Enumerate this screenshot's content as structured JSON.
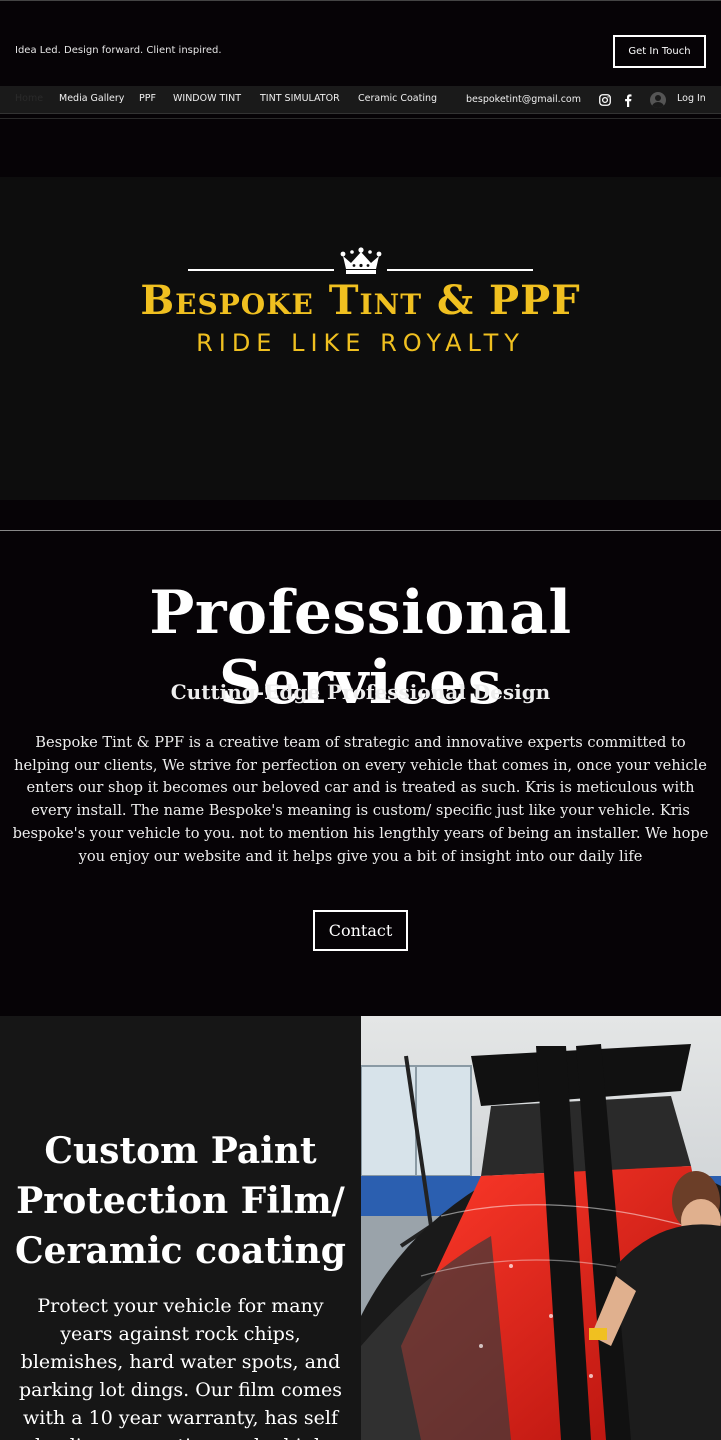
{
  "header": {
    "tagline": "Idea Led. Design forward. Client inspired.",
    "cta_label": "Get In Touch"
  },
  "nav": {
    "items": [
      {
        "label": "Home",
        "active": true
      },
      {
        "label": "Media Gallery"
      },
      {
        "label": "PPF"
      },
      {
        "label": "WINDOW TINT"
      },
      {
        "label": "TINT SIMULATOR"
      },
      {
        "label": "Ceramic Coating"
      }
    ],
    "email": "bespoketint@gmail.com",
    "social_icons": [
      "instagram-icon",
      "facebook-icon"
    ],
    "login_label": "Log In"
  },
  "hero": {
    "logo_title": "Bespoke Tint & PPF",
    "logo_subtitle": "RIDE LIKE ROYALTY",
    "accent_color": "#f0c020"
  },
  "services": {
    "title": "Professional Services",
    "subtitle": "Cutting-Edge Professional Design",
    "body": "Bespoke Tint & PPF is a creative team of strategic and innovative experts committed to helping our clients, We strive for perfection on every vehicle that comes in, once your vehicle enters our shop it becomes our beloved car and is treated as such. Kris is meticulous with every install. The name Bespoke's meaning is custom/ specific just like your vehicle. Kris bespoke's your vehicle to you. not to mention his lengthly years of being an installer. We hope you enjoy our website and it helps give you a bit of insight into our daily life",
    "contact_label": "Contact"
  },
  "ppf": {
    "title": "Custom Paint Protection Film/ Ceramic coating",
    "body": "Protect your vehicle for many years against rock chips, blemishes, hard water spots, and parking lot dings. Our film comes with a 10 year warranty, has self healing properties, and a high gloss shine"
  }
}
